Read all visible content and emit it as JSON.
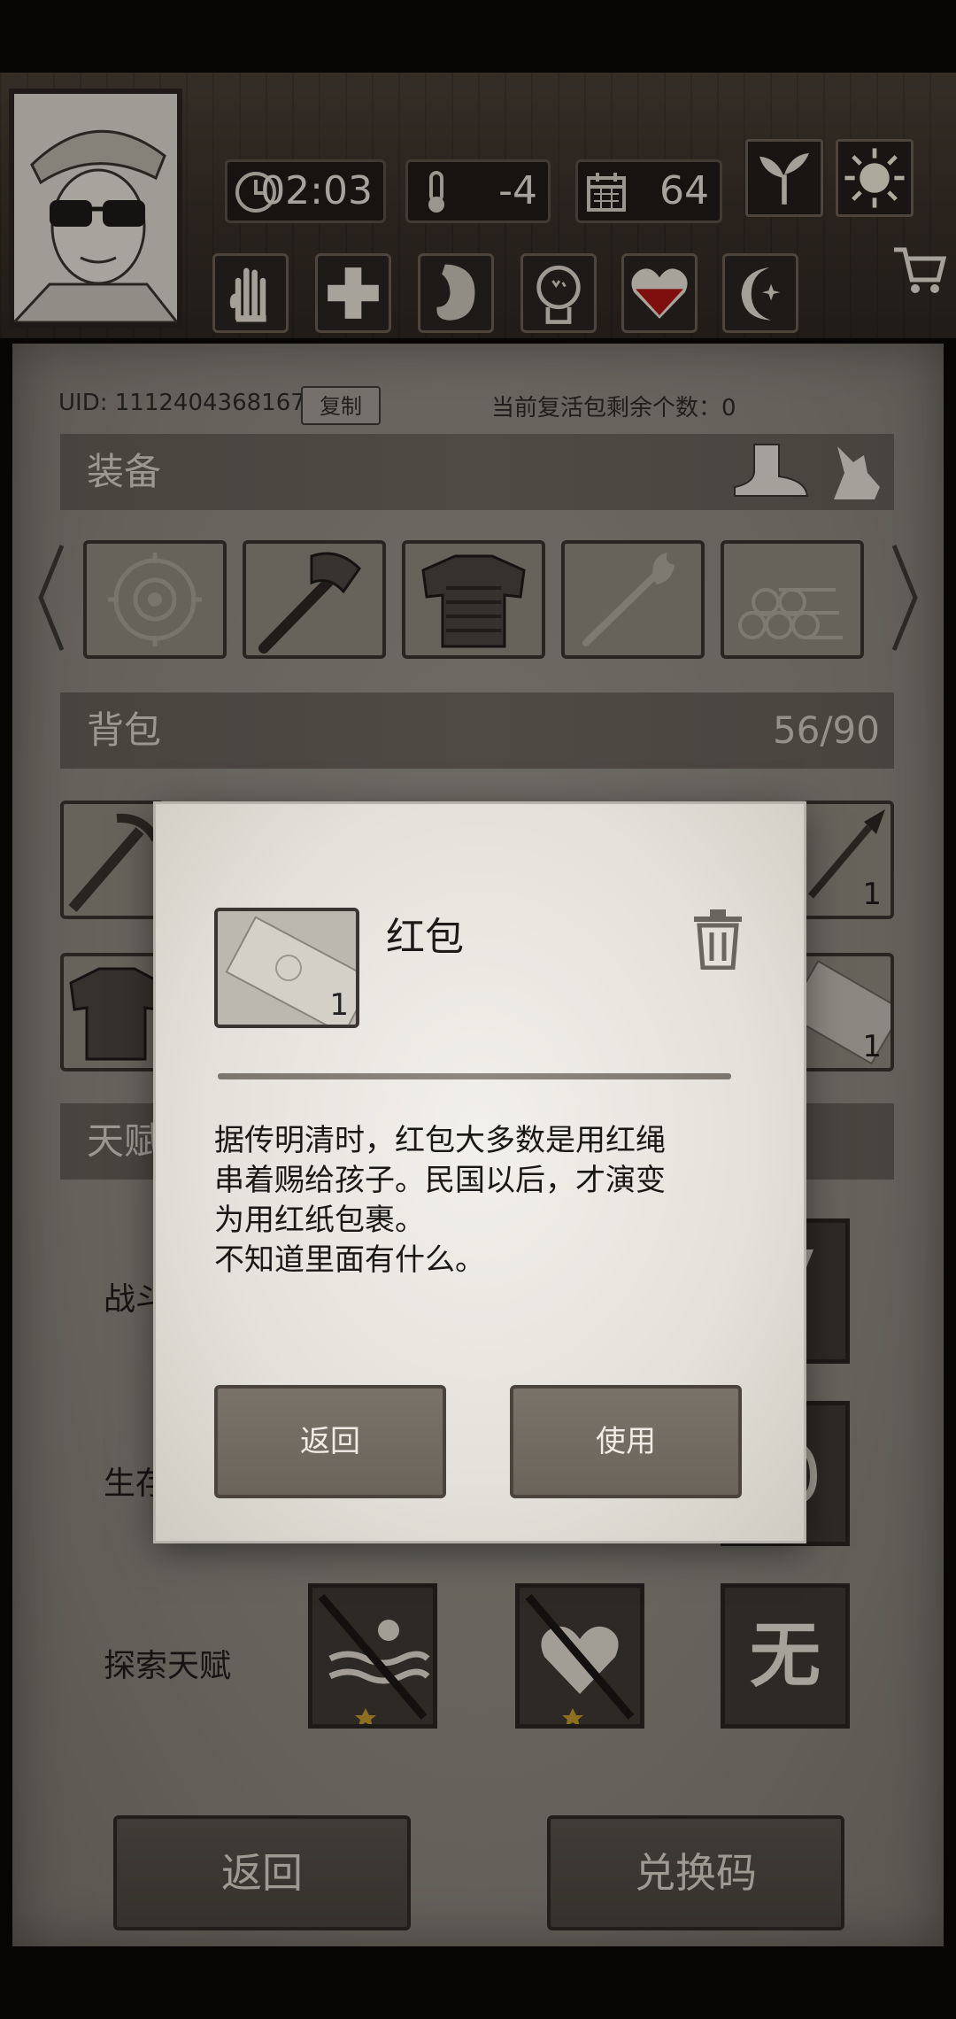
{
  "hud": {
    "time": "02:03",
    "temperature": "-4",
    "day": "64",
    "icons": [
      "clock-icon",
      "thermometer-icon",
      "calendar-icon",
      "sprout-icon",
      "sun-icon",
      "cart-icon"
    ],
    "status_icons": [
      "hand-icon",
      "health-cross-icon",
      "stomach-icon",
      "mind-icon",
      "heart-icon",
      "moon-icon"
    ],
    "heart_color": "#a81414"
  },
  "account": {
    "uid": "UID: 1112404368167",
    "copy_label": "复制",
    "revive_text": "当前复活包剩余个数：0"
  },
  "equipment": {
    "title": "装备",
    "slots": [
      "target-slot",
      "axe",
      "armor",
      "torch",
      "logs"
    ]
  },
  "backpack": {
    "title": "背包",
    "capacity": "56/90",
    "counts": [
      "1",
      "1"
    ]
  },
  "talents": {
    "title": "天赋",
    "combat_label": "战斗天赋",
    "survival_label": "生存天赋",
    "explore_label": "探索天赋",
    "none_label": "无"
  },
  "bottom": {
    "back_label": "返回",
    "redeem_label": "兑换码"
  },
  "modal": {
    "item_name": "红包",
    "item_count": "1",
    "description": "据传明清时，红包大多数是用红绳\n串着赐给孩子。民国以后，才演变\n为用红纸包裹。\n不知道里面有什么。",
    "back_label": "返回",
    "use_label": "使用"
  }
}
